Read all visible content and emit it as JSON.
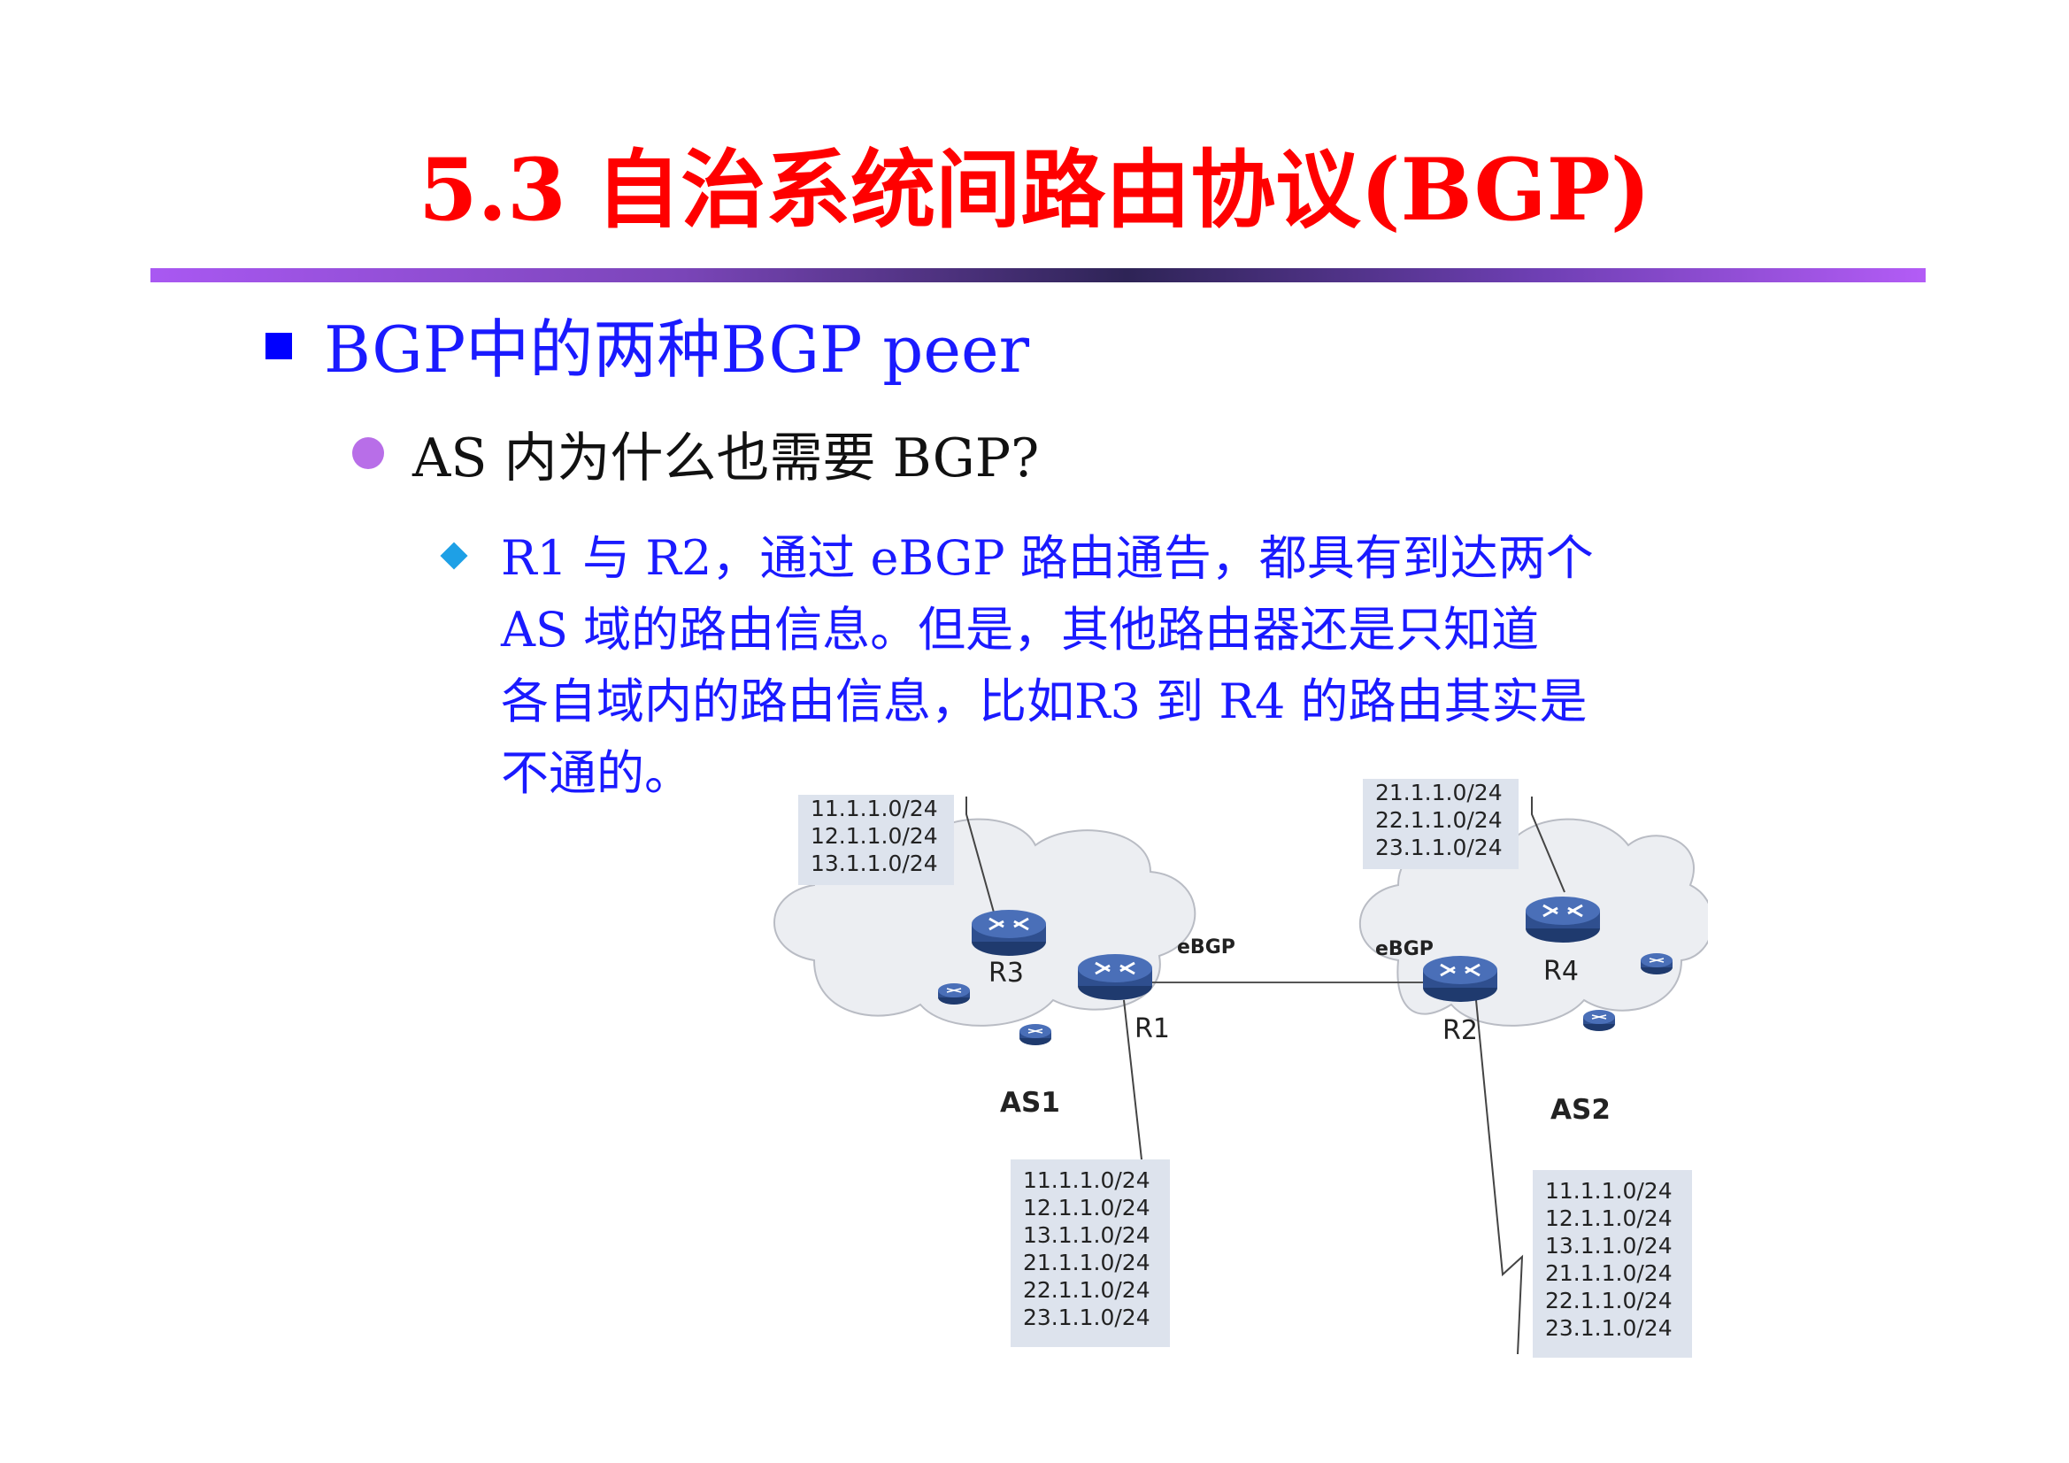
{
  "slide": {
    "title": "5.3  自治系统间路由协议(BGP)",
    "bullet1": "BGP中的两种BGP peer",
    "bullet2": "AS 内为什么也需要 BGP?",
    "bullet3_lines": [
      "R1 与 R2，通过 eBGP 路由通告，都具有到达两个",
      "AS 域的路由信息。但是，其他路由器还是只知道",
      "各自域内的路由信息，比如R3 到 R4 的路由其实是",
      "不通的。"
    ]
  },
  "diagram": {
    "routers": {
      "r1": "R1",
      "r2": "R2",
      "r3": "R3",
      "r4": "R4"
    },
    "as_labels": {
      "as1": "AS1",
      "as2": "AS2"
    },
    "link_labels": {
      "ebgp_left": "eBGP",
      "ebgp_right": "eBGP"
    },
    "route_tables": {
      "r3_table": [
        "11.1.1.0/24",
        "12.1.1.0/24",
        "13.1.1.0/24"
      ],
      "r4_table": [
        "21.1.1.0/24",
        "22.1.1.0/24",
        "23.1.1.0/24"
      ],
      "r1_table": [
        "11.1.1.0/24",
        "12.1.1.0/24",
        "13.1.1.0/24",
        "21.1.1.0/24",
        "22.1.1.0/24",
        "23.1.1.0/24"
      ],
      "r2_table": [
        "11.1.1.0/24",
        "12.1.1.0/24",
        "13.1.1.0/24",
        "21.1.1.0/24",
        "22.1.1.0/24",
        "23.1.1.0/24"
      ]
    },
    "colors": {
      "cloud": "#eceef2",
      "router": "#2f4f8f",
      "router_top": "#4a6fb8",
      "box": "#dde3ed"
    }
  }
}
